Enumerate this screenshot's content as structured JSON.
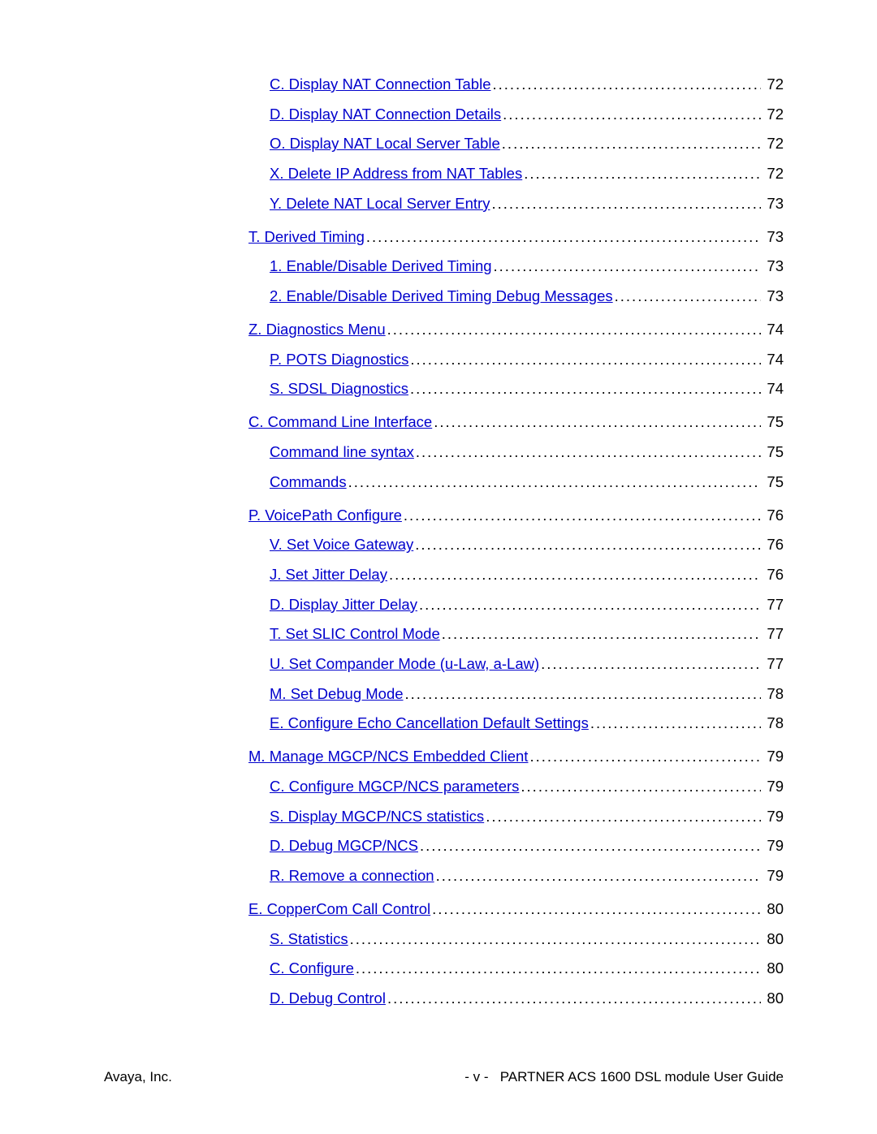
{
  "footer": {
    "left": "Avaya, Inc.",
    "center": "- v -",
    "right": "PARTNER ACS 1600 DSL module User Guide"
  },
  "toc": [
    {
      "lvl": 2,
      "label": "C. Display NAT Connection Table",
      "page": "72"
    },
    {
      "lvl": 2,
      "label": "D. Display NAT Connection Details",
      "page": "72"
    },
    {
      "lvl": 2,
      "label": "O. Display NAT Local Server Table",
      "page": "72"
    },
    {
      "lvl": 2,
      "label": "X. Delete IP Address from NAT Tables",
      "page": "72"
    },
    {
      "lvl": 2,
      "label": "Y. Delete NAT Local Server Entry",
      "page": "73"
    },
    {
      "lvl": 1,
      "label": "T. Derived Timing",
      "page": "73"
    },
    {
      "lvl": 2,
      "label": "1. Enable/Disable Derived Timing",
      "page": "73"
    },
    {
      "lvl": 2,
      "label": "2. Enable/Disable Derived Timing Debug Messages",
      "page": "73"
    },
    {
      "lvl": 1,
      "label": "Z. Diagnostics Menu",
      "page": "74"
    },
    {
      "lvl": 2,
      "label": "P. POTS Diagnostics",
      "page": "74"
    },
    {
      "lvl": 2,
      "label": "S. SDSL Diagnostics",
      "page": "74"
    },
    {
      "lvl": 1,
      "label": "C. Command Line Interface",
      "page": "75"
    },
    {
      "lvl": 2,
      "label": "Command line syntax",
      "page": "75"
    },
    {
      "lvl": 2,
      "label": "Commands",
      "page": "75"
    },
    {
      "lvl": 1,
      "label": "P. VoicePath Configure",
      "page": "76"
    },
    {
      "lvl": 2,
      "label": "V. Set Voice Gateway",
      "page": "76"
    },
    {
      "lvl": 2,
      "label": "J. Set Jitter Delay",
      "page": "76"
    },
    {
      "lvl": 2,
      "label": "D. Display Jitter Delay",
      "page": "77"
    },
    {
      "lvl": 2,
      "label": "T. Set SLIC Control Mode",
      "page": "77"
    },
    {
      "lvl": 2,
      "label": "U. Set Compander Mode (u-Law, a-Law)",
      "page": "77"
    },
    {
      "lvl": 2,
      "label": "M. Set Debug Mode",
      "page": "78"
    },
    {
      "lvl": 2,
      "label": "E. Configure Echo Cancellation Default Settings",
      "page": "78"
    },
    {
      "lvl": 1,
      "label": "M. Manage MGCP/NCS Embedded Client",
      "page": "79"
    },
    {
      "lvl": 2,
      "label": "C. Configure MGCP/NCS parameters",
      "page": "79"
    },
    {
      "lvl": 2,
      "label": "S. Display MGCP/NCS statistics",
      "page": "79"
    },
    {
      "lvl": 2,
      "label": "D. Debug MGCP/NCS",
      "page": "79"
    },
    {
      "lvl": 2,
      "label": "R. Remove a connection",
      "page": "79"
    },
    {
      "lvl": 1,
      "label": "E. CopperCom Call Control",
      "page": "80"
    },
    {
      "lvl": 2,
      "label": "S. Statistics",
      "page": "80"
    },
    {
      "lvl": 2,
      "label": "C. Configure",
      "page": "80"
    },
    {
      "lvl": 2,
      "label": "D. Debug Control",
      "page": "80"
    }
  ]
}
